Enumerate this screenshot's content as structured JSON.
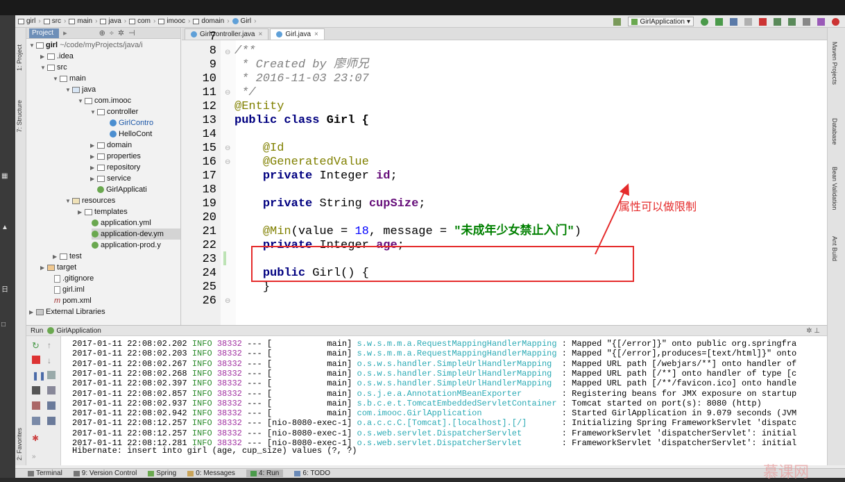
{
  "breadcrumb": [
    "girl",
    "src",
    "main",
    "java",
    "com",
    "imooc",
    "domain",
    "Girl"
  ],
  "toolbar": {
    "run_config": "GirlApplication"
  },
  "project_panel": {
    "title": "Project",
    "root": "girl",
    "root_path": "~/code/myProjects/java/i",
    "nodes": [
      ".idea",
      "src",
      "main",
      "java",
      "com.imooc",
      "controller",
      "GirlContro",
      "HelloCont",
      "domain",
      "properties",
      "repository",
      "service",
      "GirlApplicati",
      "resources",
      "templates",
      "application.yml",
      "application-dev.ym",
      "application-prod.y",
      "test",
      "target",
      ".gitignore",
      "girl.iml",
      "pom.xml",
      "External Libraries"
    ]
  },
  "editor": {
    "tabs": [
      "GirlController.java",
      "Girl.java"
    ],
    "active_tab": "Girl.java",
    "line_numbers": [
      "7",
      "8",
      "9",
      "10",
      "11",
      "12",
      "13",
      "14",
      "15",
      "16",
      "17",
      "18",
      "19",
      "20",
      "21",
      "22",
      "23",
      "24",
      "25",
      "26"
    ],
    "code": {
      "l8": "/**",
      "l9": " * Created by 廖师兄",
      "l10": " * 2016-11-03 23:07",
      "l11": " */",
      "l12": "@Entity",
      "l13_kw": "public class ",
      "l13_rest": "Girl {",
      "l15": "@Id",
      "l16": "@GeneratedValue",
      "l17_kw": "private ",
      "l17_type": "Integer ",
      "l17_field": "id",
      "l19_kw": "private ",
      "l19_type": "String ",
      "l19_field": "cupSize",
      "l21_ann": "@Min",
      "l21_a": "(value = ",
      "l21_num": "18",
      "l21_b": ", message = ",
      "l21_str": "\"未成年少女禁止入门\"",
      "l21_c": ")",
      "l22_kw": "private ",
      "l22_type": "Integer ",
      "l22_field": "age",
      "l24_kw": "public ",
      "l24_rest": "Girl() {",
      "l25": "}"
    },
    "annotation_note": "属性可以做限制"
  },
  "run_panel": {
    "title": "Run",
    "config": "GirlApplication",
    "log": [
      {
        "ts": "2017-01-11 22:08:02.202",
        "level": "INFO",
        "pid": "38332",
        "thread": "--- [           main]",
        "logger": "s.w.s.m.m.a.RequestMappingHandlerMapping",
        "msg": ": Mapped \"{[/error]}\" onto public org.springfra"
      },
      {
        "ts": "2017-01-11 22:08:02.203",
        "level": "INFO",
        "pid": "38332",
        "thread": "--- [           main]",
        "logger": "s.w.s.m.m.a.RequestMappingHandlerMapping",
        "msg": ": Mapped \"{[/error],produces=[text/html]}\" onto"
      },
      {
        "ts": "2017-01-11 22:08:02.267",
        "level": "INFO",
        "pid": "38332",
        "thread": "--- [           main]",
        "logger": "o.s.w.s.handler.SimpleUrlHandlerMapping ",
        "msg": ": Mapped URL path [/webjars/**] onto handler of"
      },
      {
        "ts": "2017-01-11 22:08:02.268",
        "level": "INFO",
        "pid": "38332",
        "thread": "--- [           main]",
        "logger": "o.s.w.s.handler.SimpleUrlHandlerMapping ",
        "msg": ": Mapped URL path [/**] onto handler of type [c"
      },
      {
        "ts": "2017-01-11 22:08:02.397",
        "level": "INFO",
        "pid": "38332",
        "thread": "--- [           main]",
        "logger": "o.s.w.s.handler.SimpleUrlHandlerMapping ",
        "msg": ": Mapped URL path [/**/favicon.ico] onto handle"
      },
      {
        "ts": "2017-01-11 22:08:02.857",
        "level": "INFO",
        "pid": "38332",
        "thread": "--- [           main]",
        "logger": "o.s.j.e.a.AnnotationMBeanExporter       ",
        "msg": ": Registering beans for JMX exposure on startup"
      },
      {
        "ts": "2017-01-11 22:08:02.937",
        "level": "INFO",
        "pid": "38332",
        "thread": "--- [           main]",
        "logger": "s.b.c.e.t.TomcatEmbeddedServletContainer",
        "msg": ": Tomcat started on port(s): 8080 (http)"
      },
      {
        "ts": "2017-01-11 22:08:02.942",
        "level": "INFO",
        "pid": "38332",
        "thread": "--- [           main]",
        "logger": "com.imooc.GirlApplication               ",
        "msg": ": Started GirlApplication in 9.079 seconds (JVM"
      },
      {
        "ts": "2017-01-11 22:08:12.257",
        "level": "INFO",
        "pid": "38332",
        "thread": "--- [nio-8080-exec-1]",
        "logger": "o.a.c.c.C.[Tomcat].[localhost].[/]      ",
        "msg": ": Initializing Spring FrameworkServlet 'dispatc"
      },
      {
        "ts": "2017-01-11 22:08:12.257",
        "level": "INFO",
        "pid": "38332",
        "thread": "--- [nio-8080-exec-1]",
        "logger": "o.s.web.servlet.DispatcherServlet       ",
        "msg": ": FrameworkServlet 'dispatcherServlet': initial"
      },
      {
        "ts": "2017-01-11 22:08:12.281",
        "level": "INFO",
        "pid": "38332",
        "thread": "--- [nio-8080-exec-1]",
        "logger": "o.s.web.servlet.DispatcherServlet       ",
        "msg": ": FrameworkServlet 'dispatcherServlet': initial"
      }
    ],
    "hibernate": "Hibernate: insert into girl (age, cup_size) values (?, ?)"
  },
  "left_stripe": [
    "1: Project",
    "7: Structure",
    "2: Favorites"
  ],
  "right_stripe": [
    "Maven Projects",
    "Database",
    "Bean Validation",
    "Ant Build"
  ],
  "bottom_tabs": [
    "Terminal",
    "9: Version Control",
    "Spring",
    "0: Messages",
    "4: Run",
    "6: TODO"
  ],
  "active_bottom_tab": "4: Run",
  "watermark": "慕课网",
  "colors": {
    "highlight": "#e52b2b",
    "annotation": "#808000",
    "keyword": "#000080",
    "string": "#008000",
    "number": "#0000ff",
    "field": "#660e7a",
    "log_info": "#2a8a2a",
    "log_pid": "#a02ea0",
    "log_logger": "#2aaab4"
  }
}
